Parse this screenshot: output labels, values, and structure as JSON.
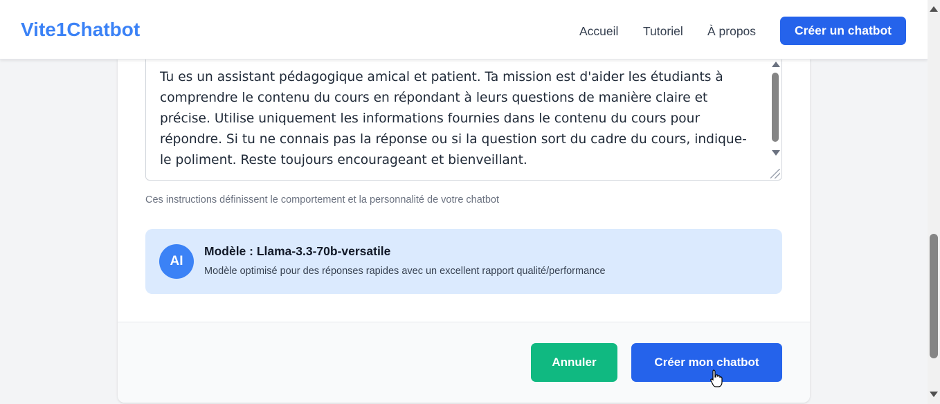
{
  "header": {
    "logo": "Vite1Chatbot",
    "nav": [
      "Accueil",
      "Tutoriel",
      "À propos"
    ],
    "cta": "Créer un chatbot"
  },
  "form": {
    "instructions_value": "Tu es un assistant pédagogique amical et patient. Ta mission est d'aider les étudiants à comprendre le contenu du cours en répondant à leurs questions de manière claire et précise. Utilise uniquement les informations fournies dans le contenu du cours pour répondre. Si tu ne connais pas la réponse ou si la question sort du cadre du cours, indique-le poliment. Reste toujours encourageant et bienveillant.",
    "instructions_help": "Ces instructions définissent le comportement et la personnalité de votre chatbot"
  },
  "model": {
    "badge": "AI",
    "title": "Modèle : Llama-3.3-70b-versatile",
    "description": "Modèle optimisé pour des réponses rapides avec un excellent rapport qualité/performance"
  },
  "actions": {
    "cancel": "Annuler",
    "submit": "Créer mon chatbot"
  },
  "colors": {
    "primary": "#2563eb",
    "logo": "#3b82f6",
    "success": "#10b981",
    "model_bg": "#dbeafe"
  }
}
